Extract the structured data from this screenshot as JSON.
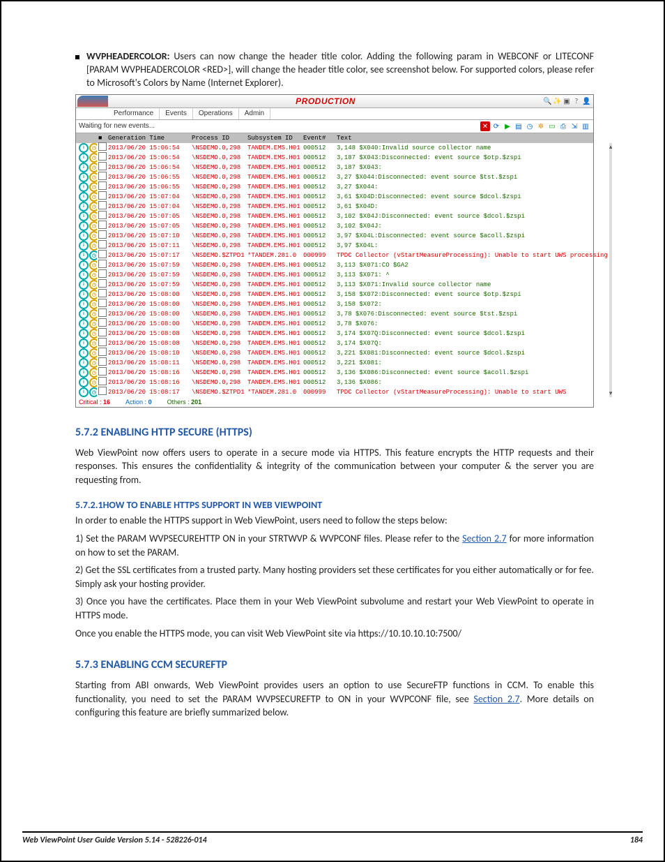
{
  "bullet": {
    "k": "WVPHEADERCOLOR:",
    "txt": " Users can now change the header title color. Adding the following param in WEBCONF or LITECONF [PARAM WVPHEADERCOLOR <RED>], will change the header title color, see screenshot below. For supported colors, please refer to Microsoft's Colors by Name (Internet Explorer)."
  },
  "shot": {
    "title": "PRODUCTION",
    "tabs": [
      "Performance",
      "Events",
      "Operations",
      "Admin"
    ],
    "status": "Waiting for new events...",
    "cols": [
      "",
      "",
      "Generation Time",
      "Process ID",
      "Subsystem ID",
      "Event#",
      "Text"
    ],
    "rows": [
      [
        "2013/06/20 15:06:54",
        "\\NSDEMO.0,298",
        "TANDEM.EMS.H01",
        "000512",
        "3,148 $X040:Invalid source collector name"
      ],
      [
        "2013/06/20 15:06:54",
        "\\NSDEMO.0,298",
        "TANDEM.EMS.H01",
        "000512",
        "3,187 $X043:Disconnected: event source $otp.$zspi"
      ],
      [
        "2013/06/20 15:06:54",
        "\\NSDEMO.0,298",
        "TANDEM.EMS.H01",
        "000512",
        "3,187 $X043:"
      ],
      [
        "2013/06/20 15:06:55",
        "\\NSDEMO.0,298",
        "TANDEM.EMS.H01",
        "000512",
        "3,27 $X044:Disconnected: event source $tst.$zspi"
      ],
      [
        "2013/06/20 15:06:55",
        "\\NSDEMO.0,298",
        "TANDEM.EMS.H01",
        "000512",
        "3,27 $X044:"
      ],
      [
        "2013/06/20 15:07:04",
        "\\NSDEMO.0,298",
        "TANDEM.EMS.H01",
        "000512",
        "3,61 $X04D:Disconnected: event source $dcol.$zspi"
      ],
      [
        "2013/06/20 15:07:04",
        "\\NSDEMO.0,298",
        "TANDEM.EMS.H01",
        "000512",
        "3,61 $X04D:"
      ],
      [
        "2013/06/20 15:07:05",
        "\\NSDEMO.0,298",
        "TANDEM.EMS.H01",
        "000512",
        "3,102 $X04J:Disconnected: event source $dcol.$zspi"
      ],
      [
        "2013/06/20 15:07:05",
        "\\NSDEMO.0,298",
        "TANDEM.EMS.H01",
        "000512",
        "3,102 $X04J:"
      ],
      [
        "2013/06/20 15:07:10",
        "\\NSDEMO.0,298",
        "TANDEM.EMS.H01",
        "000512",
        "3,97 $X04L:Disconnected: event source $acoll.$zspi"
      ],
      [
        "2013/06/20 15:07:11",
        "\\NSDEMO.0,298",
        "TANDEM.EMS.H01",
        "000512",
        "3,97 $X04L:"
      ],
      [
        "2013/06/20 15:07:17",
        "\\NSDEMO.$ZTPD1",
        "*TANDEM.281.0",
        "000999",
        "TPDC Collector (vStartMeasureProcessing): Unable to start UWS processing"
      ],
      [
        "2013/06/20 15:07:59",
        "\\NSDEMO.0,298",
        "TANDEM.EMS.H01",
        "000512",
        "3,113 $X071:CO $GA2"
      ],
      [
        "2013/06/20 15:07:59",
        "\\NSDEMO.0,298",
        "TANDEM.EMS.H01",
        "000512",
        "3,113 $X071:   ^"
      ],
      [
        "2013/06/20 15:07:59",
        "\\NSDEMO.0,298",
        "TANDEM.EMS.H01",
        "000512",
        "3,113 $X071:Invalid source collector name"
      ],
      [
        "2013/06/20 15:08:00",
        "\\NSDEMO.0,298",
        "TANDEM.EMS.H01",
        "000512",
        "3,158 $X072:Disconnected: event source $otp.$zspi"
      ],
      [
        "2013/06/20 15:08:00",
        "\\NSDEMO.0,298",
        "TANDEM.EMS.H01",
        "000512",
        "3,158 $X072:"
      ],
      [
        "2013/06/20 15:08:00",
        "\\NSDEMO.0,298",
        "TANDEM.EMS.H01",
        "000512",
        "3,78 $X076:Disconnected: event source $tst.$zspi"
      ],
      [
        "2013/06/20 15:08:00",
        "\\NSDEMO.0,298",
        "TANDEM.EMS.H01",
        "000512",
        "3,78 $X076:"
      ],
      [
        "2013/06/20 15:08:08",
        "\\NSDEMO.0,298",
        "TANDEM.EMS.H01",
        "000512",
        "3,174 $X07Q:Disconnected: event source $dcol.$zspi"
      ],
      [
        "2013/06/20 15:08:08",
        "\\NSDEMO.0,298",
        "TANDEM.EMS.H01",
        "000512",
        "3,174 $X07Q:"
      ],
      [
        "2013/06/20 15:08:10",
        "\\NSDEMO.0,298",
        "TANDEM.EMS.H01",
        "000512",
        "3,221 $X081:Disconnected: event source $dcol.$zspi"
      ],
      [
        "2013/06/20 15:08:11",
        "\\NSDEMO.0,298",
        "TANDEM.EMS.H01",
        "000512",
        "3,221 $X081:"
      ],
      [
        "2013/06/20 15:08:16",
        "\\NSDEMO.0,298",
        "TANDEM.EMS.H01",
        "000512",
        "3,136 $X086:Disconnected: event source $acoll.$zspi"
      ],
      [
        "2013/06/20 15:08:16",
        "\\NSDEMO.0,298",
        "TANDEM.EMS.H01",
        "000512",
        "3,136 $X086:"
      ],
      [
        "2013/06/20 15:08:17",
        "\\NSDEMO.$ZTPD1",
        "*TANDEM.281.0",
        "000999",
        "TPDC Collector (vStartMeasureProcessing): Unable to start UWS"
      ]
    ],
    "footer": {
      "crit_l": "Critical :",
      "crit_v": "16",
      "act_l": "Action :",
      "act_v": "0",
      "oth_l": "Others :",
      "oth_v": "201"
    }
  },
  "s572": {
    "h": "5.7.2    ENABLING HTTP SECURE (HTTPS)",
    "p1": "Web ViewPoint now offers users to operate in a secure mode via HTTPS. This feature encrypts the HTTP requests and their responses. This ensures the confidentiality & integrity of the communication between your computer & the server you are requesting from.",
    "sub": "5.7.2.1HOW TO ENABLE HTTPS SUPPORT IN WEB VIEWPOINT",
    "l1": "In order to enable the HTTPS support in Web ViewPoint, users need to follow the steps below:",
    "n1a": "1) Set the PARAM WVPSECUREHTTP ON in your STRTWVP & WVPCONF files. Please refer to the ",
    "n1link": "Section 2.7",
    "n1b": " for more information on how to set the PARAM.",
    "n2": "2) Get the SSL certificates from a trusted party. Many hosting providers set these certificates for you either automatically or for fee. Simply ask your hosting provider.",
    "n3": "3) Once you have the certificates. Place them in your Web ViewPoint subvolume and restart your Web ViewPoint to operate in HTTPS mode.",
    "n4": "Once you enable the HTTPS mode, you can visit Web ViewPoint site via https://10.10.10.10:7500/"
  },
  "s573": {
    "h": "5.7.3    ENABLING CCM SECUREFTP",
    "p1a": "Starting from ABI onwards, Web ViewPoint provides users an option to use SecureFTP functions in CCM. To enable this functionality, you need to set the PARAM WVPSECUREFTP to ON in your WVPCONF file, see ",
    "p1link": "Section 2.7",
    "p1b": ". More details on configuring this feature are briefly summarized below."
  },
  "footer": {
    "left": "Web ViewPoint User Guide Version 5.14 - 528226-014",
    "right": "184"
  }
}
